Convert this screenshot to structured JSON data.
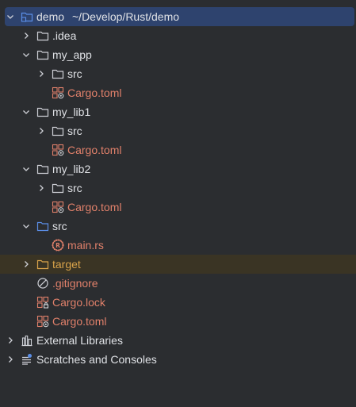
{
  "colors": {
    "background": "#2b2d30",
    "selection": "#2e436e",
    "excluded_row": "#3a3424",
    "text": "#dfe1e5",
    "toml_file": "#e0806a",
    "excluded_folder": "#d9a34a",
    "source_folder": "#5b8fe8"
  },
  "tree": {
    "root": {
      "label": "demo",
      "path": "~/Develop/Rust/demo",
      "icon": "module-folder-icon",
      "expanded": true
    },
    "idea": {
      "label": ".idea",
      "icon": "folder-icon",
      "expanded": false
    },
    "my_app": {
      "label": "my_app",
      "icon": "folder-icon",
      "expanded": true
    },
    "my_app_src": {
      "label": "src",
      "icon": "folder-icon",
      "expanded": false
    },
    "my_app_cargo": {
      "label": "Cargo.toml",
      "icon": "cargo-toml-icon"
    },
    "my_lib1": {
      "label": "my_lib1",
      "icon": "folder-icon",
      "expanded": true
    },
    "my_lib1_src": {
      "label": "src",
      "icon": "folder-icon",
      "expanded": false
    },
    "my_lib1_cargo": {
      "label": "Cargo.toml",
      "icon": "cargo-toml-icon"
    },
    "my_lib2": {
      "label": "my_lib2",
      "icon": "folder-icon",
      "expanded": true
    },
    "my_lib2_src": {
      "label": "src",
      "icon": "folder-icon",
      "expanded": false
    },
    "my_lib2_cargo": {
      "label": "Cargo.toml",
      "icon": "cargo-toml-icon"
    },
    "src": {
      "label": "src",
      "icon": "source-folder-icon",
      "expanded": true
    },
    "main_rs": {
      "label": "main.rs",
      "icon": "rust-file-icon"
    },
    "target": {
      "label": "target",
      "icon": "excluded-folder-icon",
      "expanded": false
    },
    "gitignore": {
      "label": ".gitignore",
      "icon": "ignore-file-icon"
    },
    "cargo_lock": {
      "label": "Cargo.lock",
      "icon": "cargo-lock-icon"
    },
    "cargo_toml": {
      "label": "Cargo.toml",
      "icon": "cargo-toml-icon"
    },
    "external_libraries": {
      "label": "External Libraries",
      "icon": "library-icon",
      "expanded": false
    },
    "scratches": {
      "label": "Scratches and Consoles",
      "icon": "scratches-icon",
      "expanded": false
    }
  }
}
